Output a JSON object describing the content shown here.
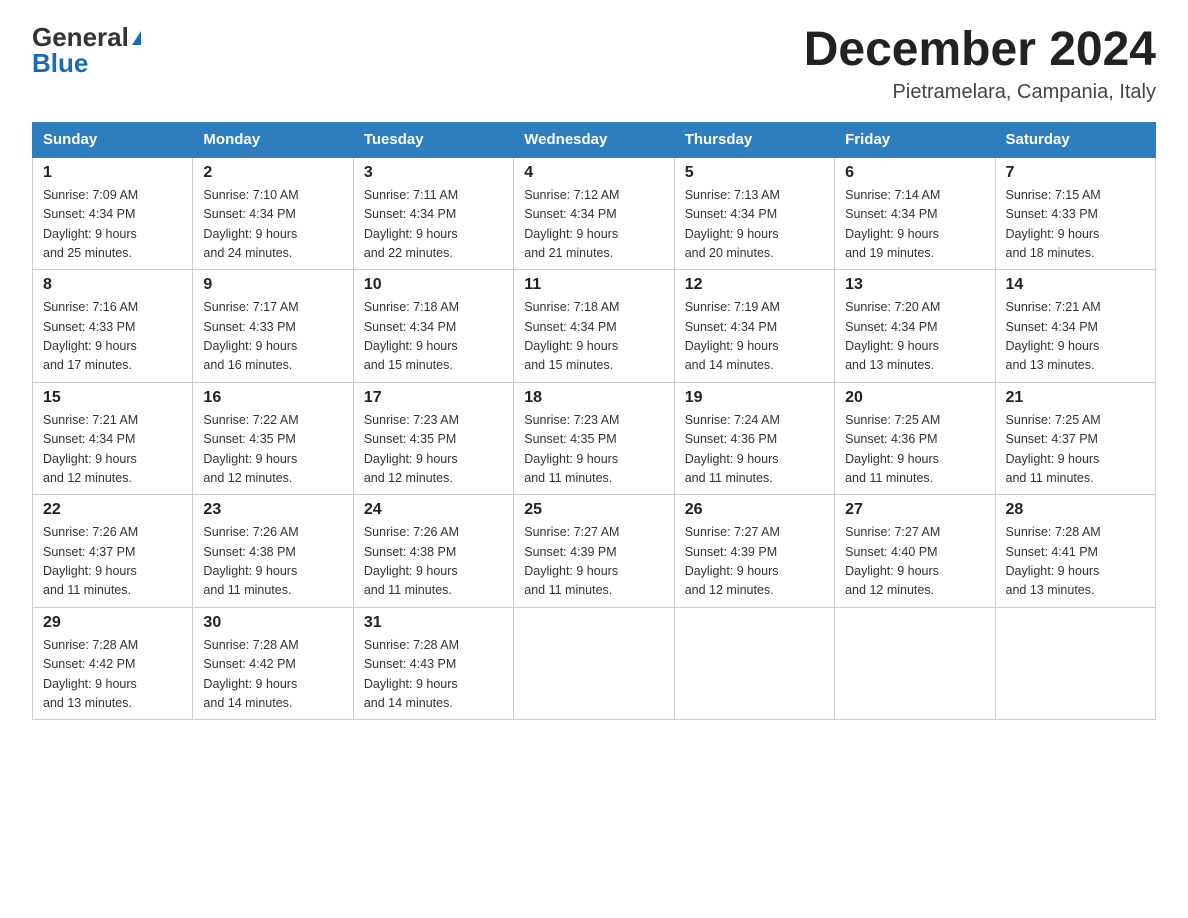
{
  "logo": {
    "general": "General",
    "blue": "Blue",
    "triangle": "▶"
  },
  "title": "December 2024",
  "location": "Pietramelara, Campania, Italy",
  "days_of_week": [
    "Sunday",
    "Monday",
    "Tuesday",
    "Wednesday",
    "Thursday",
    "Friday",
    "Saturday"
  ],
  "weeks": [
    [
      {
        "day": "1",
        "sunrise": "7:09 AM",
        "sunset": "4:34 PM",
        "daylight": "9 hours and 25 minutes."
      },
      {
        "day": "2",
        "sunrise": "7:10 AM",
        "sunset": "4:34 PM",
        "daylight": "9 hours and 24 minutes."
      },
      {
        "day": "3",
        "sunrise": "7:11 AM",
        "sunset": "4:34 PM",
        "daylight": "9 hours and 22 minutes."
      },
      {
        "day": "4",
        "sunrise": "7:12 AM",
        "sunset": "4:34 PM",
        "daylight": "9 hours and 21 minutes."
      },
      {
        "day": "5",
        "sunrise": "7:13 AM",
        "sunset": "4:34 PM",
        "daylight": "9 hours and 20 minutes."
      },
      {
        "day": "6",
        "sunrise": "7:14 AM",
        "sunset": "4:34 PM",
        "daylight": "9 hours and 19 minutes."
      },
      {
        "day": "7",
        "sunrise": "7:15 AM",
        "sunset": "4:33 PM",
        "daylight": "9 hours and 18 minutes."
      }
    ],
    [
      {
        "day": "8",
        "sunrise": "7:16 AM",
        "sunset": "4:33 PM",
        "daylight": "9 hours and 17 minutes."
      },
      {
        "day": "9",
        "sunrise": "7:17 AM",
        "sunset": "4:33 PM",
        "daylight": "9 hours and 16 minutes."
      },
      {
        "day": "10",
        "sunrise": "7:18 AM",
        "sunset": "4:34 PM",
        "daylight": "9 hours and 15 minutes."
      },
      {
        "day": "11",
        "sunrise": "7:18 AM",
        "sunset": "4:34 PM",
        "daylight": "9 hours and 15 minutes."
      },
      {
        "day": "12",
        "sunrise": "7:19 AM",
        "sunset": "4:34 PM",
        "daylight": "9 hours and 14 minutes."
      },
      {
        "day": "13",
        "sunrise": "7:20 AM",
        "sunset": "4:34 PM",
        "daylight": "9 hours and 13 minutes."
      },
      {
        "day": "14",
        "sunrise": "7:21 AM",
        "sunset": "4:34 PM",
        "daylight": "9 hours and 13 minutes."
      }
    ],
    [
      {
        "day": "15",
        "sunrise": "7:21 AM",
        "sunset": "4:34 PM",
        "daylight": "9 hours and 12 minutes."
      },
      {
        "day": "16",
        "sunrise": "7:22 AM",
        "sunset": "4:35 PM",
        "daylight": "9 hours and 12 minutes."
      },
      {
        "day": "17",
        "sunrise": "7:23 AM",
        "sunset": "4:35 PM",
        "daylight": "9 hours and 12 minutes."
      },
      {
        "day": "18",
        "sunrise": "7:23 AM",
        "sunset": "4:35 PM",
        "daylight": "9 hours and 11 minutes."
      },
      {
        "day": "19",
        "sunrise": "7:24 AM",
        "sunset": "4:36 PM",
        "daylight": "9 hours and 11 minutes."
      },
      {
        "day": "20",
        "sunrise": "7:25 AM",
        "sunset": "4:36 PM",
        "daylight": "9 hours and 11 minutes."
      },
      {
        "day": "21",
        "sunrise": "7:25 AM",
        "sunset": "4:37 PM",
        "daylight": "9 hours and 11 minutes."
      }
    ],
    [
      {
        "day": "22",
        "sunrise": "7:26 AM",
        "sunset": "4:37 PM",
        "daylight": "9 hours and 11 minutes."
      },
      {
        "day": "23",
        "sunrise": "7:26 AM",
        "sunset": "4:38 PM",
        "daylight": "9 hours and 11 minutes."
      },
      {
        "day": "24",
        "sunrise": "7:26 AM",
        "sunset": "4:38 PM",
        "daylight": "9 hours and 11 minutes."
      },
      {
        "day": "25",
        "sunrise": "7:27 AM",
        "sunset": "4:39 PM",
        "daylight": "9 hours and 11 minutes."
      },
      {
        "day": "26",
        "sunrise": "7:27 AM",
        "sunset": "4:39 PM",
        "daylight": "9 hours and 12 minutes."
      },
      {
        "day": "27",
        "sunrise": "7:27 AM",
        "sunset": "4:40 PM",
        "daylight": "9 hours and 12 minutes."
      },
      {
        "day": "28",
        "sunrise": "7:28 AM",
        "sunset": "4:41 PM",
        "daylight": "9 hours and 13 minutes."
      }
    ],
    [
      {
        "day": "29",
        "sunrise": "7:28 AM",
        "sunset": "4:42 PM",
        "daylight": "9 hours and 13 minutes."
      },
      {
        "day": "30",
        "sunrise": "7:28 AM",
        "sunset": "4:42 PM",
        "daylight": "9 hours and 14 minutes."
      },
      {
        "day": "31",
        "sunrise": "7:28 AM",
        "sunset": "4:43 PM",
        "daylight": "9 hours and 14 minutes."
      },
      null,
      null,
      null,
      null
    ]
  ],
  "labels": {
    "sunrise": "Sunrise:",
    "sunset": "Sunset:",
    "daylight": "Daylight:"
  }
}
